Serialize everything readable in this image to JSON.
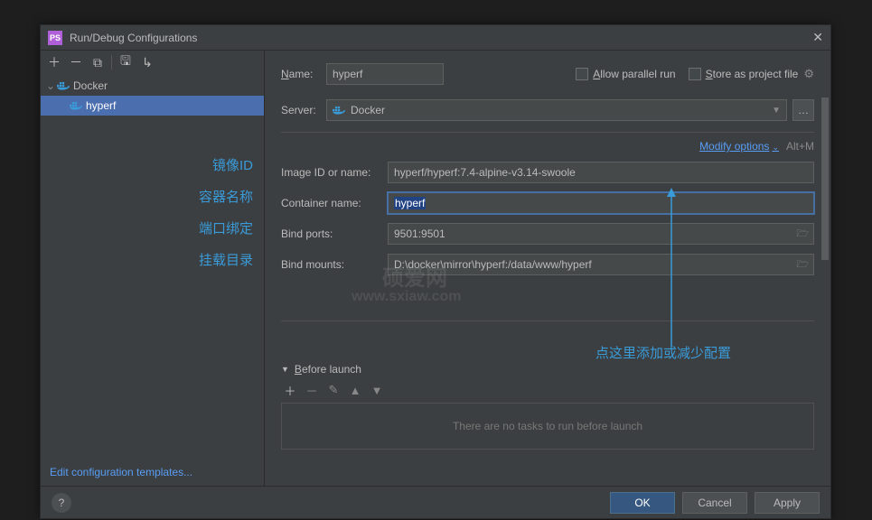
{
  "titlebar": {
    "title": "Run/Debug Configurations"
  },
  "sidebar": {
    "tree": {
      "root": "Docker",
      "child": "hyperf"
    },
    "annotations": {
      "a1": "镜像ID",
      "a2": "容器名称",
      "a3": "端口绑定",
      "a4": "挂载目录"
    },
    "edit_templates": "Edit configuration templates..."
  },
  "main": {
    "name_label": "Name:",
    "name_value": "hyperf",
    "allow_parallel": "Allow parallel run",
    "store_project": "Store as project file",
    "server_label": "Server:",
    "server_value": "Docker",
    "modify_options": "Modify options",
    "shortcut": "Alt+M",
    "image_label": "Image ID or name:",
    "image_value": "hyperf/hyperf:7.4-alpine-v3.14-swoole",
    "container_label": "Container name:",
    "container_value": "hyperf",
    "ports_label": "Bind ports:",
    "ports_value": "9501:9501",
    "mounts_label": "Bind mounts:",
    "mounts_value": "D:\\docker\\mirror\\hyperf:/data/www/hyperf",
    "watermark_top": "硕爱网",
    "watermark_bottom": "www.sxiaw.com",
    "before_launch": "Before launch",
    "bl_empty": "There are no tasks to run before launch",
    "callout": "点这里添加或减少配置"
  },
  "footer": {
    "ok": "OK",
    "cancel": "Cancel",
    "apply": "Apply"
  }
}
